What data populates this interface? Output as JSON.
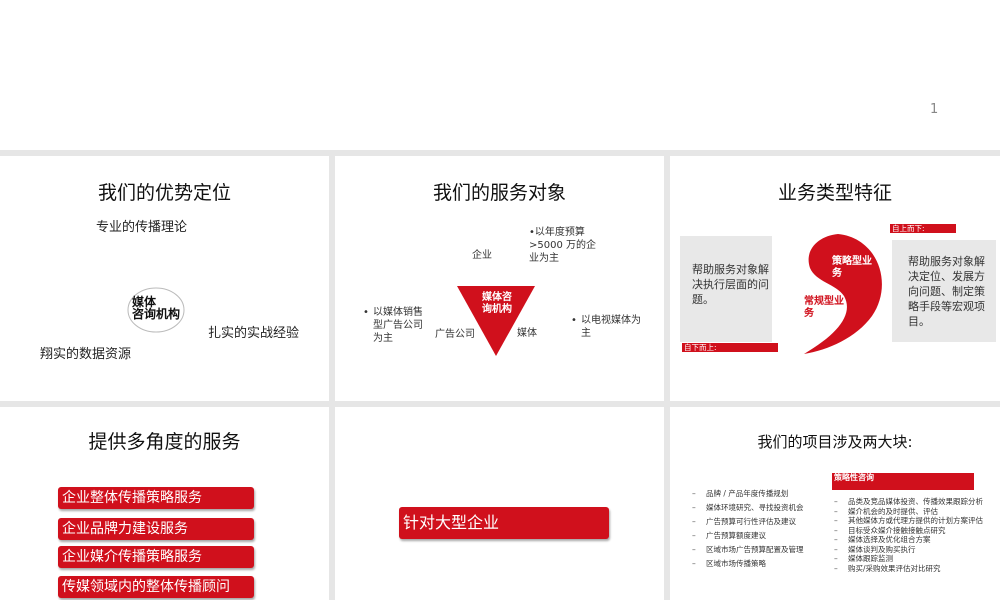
{
  "page_number": "1",
  "panel1": {
    "title": "我们的优势定位",
    "item_top": "专业的传播理论",
    "center_line1": "媒体",
    "center_line2": "咨询机构",
    "item_right": "扎实的实战经验",
    "item_left": "翔实的数据资源"
  },
  "panel2": {
    "title": "我们的服务对象",
    "triangle_line1": "媒体咨",
    "triangle_line2": "询机构",
    "label_top": "企业",
    "label_left": "广告公司",
    "label_right": "媒体",
    "note_top": "•以年度预算>5000 万的企业为主",
    "note_left": "以媒体销售型广告公司为主",
    "note_right": "以电视媒体为主"
  },
  "panel3": {
    "title": "业务类型特征",
    "left_text": "帮助服务对象解决执行层面的问题。",
    "right_text": "帮助服务对象解决定位、发展方向问题、制定策略手段等宏观项目。",
    "top_bar": "自上而下:",
    "bottom_bar": "自下而上:",
    "shape_top": "策略型业务",
    "shape_bottom": "常规型业务"
  },
  "panel4": {
    "title": "提供多角度的服务",
    "items": [
      "企业整体传播策略服务",
      "企业品牌力建设服务",
      "企业媒介传播策略服务",
      "传媒领域内的整体传播顾问"
    ]
  },
  "panel5": {
    "label": "针对大型企业"
  },
  "panel6": {
    "title": "我们的项目涉及两大块:",
    "left_items": [
      "品牌 / 产品年度传播规划",
      "媒体环境研究、寻找投资机会",
      "广告预算可行性评估及建议",
      "广告预算额度建议",
      "区域市场广告预算配置及管理",
      "区域市场传播策略"
    ],
    "right_header": "策略性咨询",
    "right_items": [
      "品类及竞品媒体投资、传播效果跟踪分析",
      "媒介机会的及时提供、评估",
      "其他媒体方或代理方提供的计划方案评估",
      "目标受众媒介接触接触点研究",
      "媒体选择及优化组合方案",
      "媒体谈判及购买执行",
      "媒体跟踪监测",
      "购买/采购效果评估对比研究"
    ]
  },
  "colors": {
    "accent": "#d0101c"
  }
}
